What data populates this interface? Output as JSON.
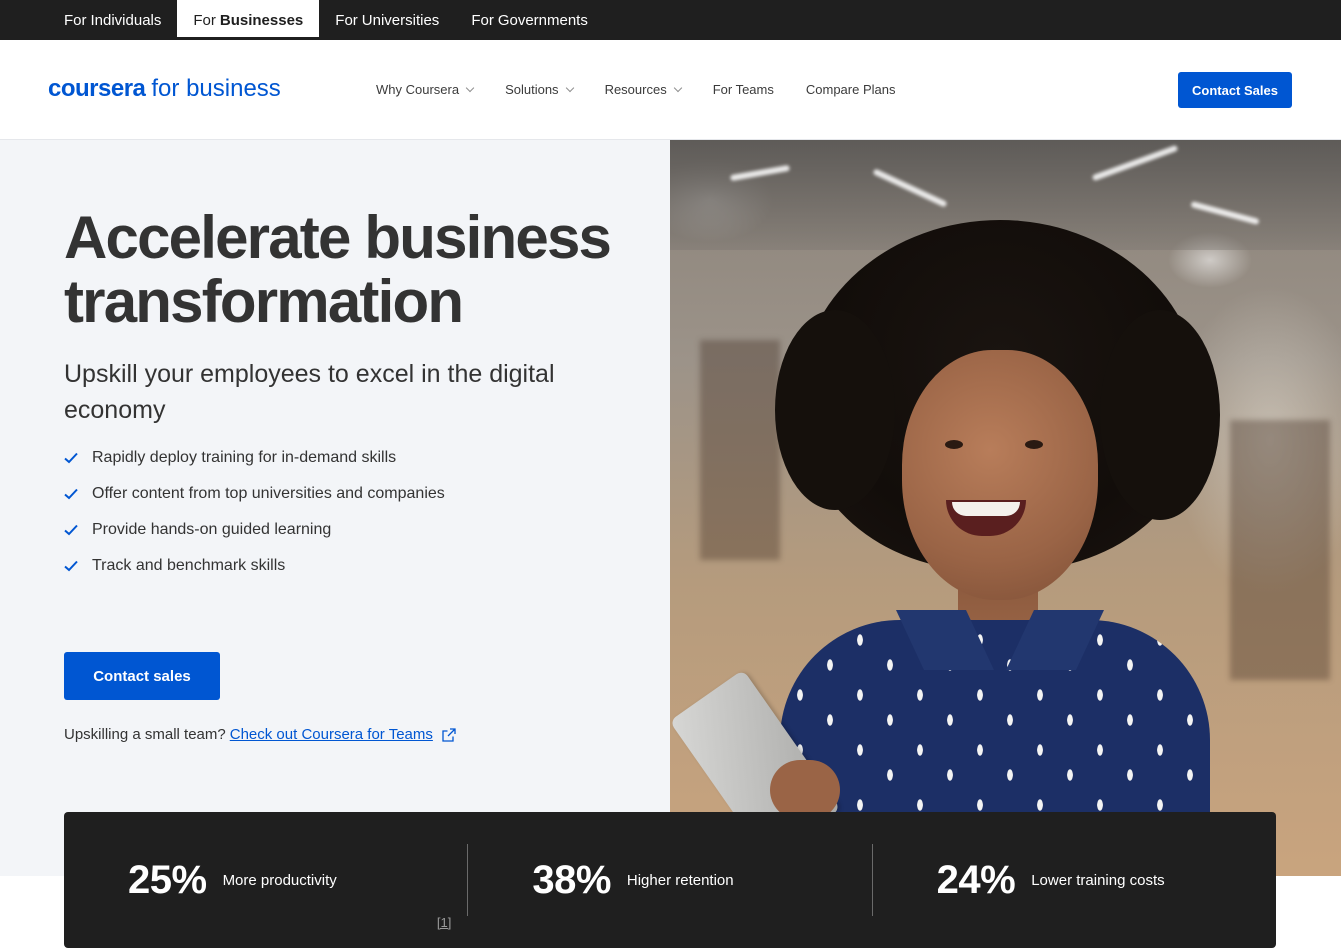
{
  "audience_tabs": [
    {
      "prefix": "For",
      "name": "Individuals",
      "active": false
    },
    {
      "prefix": "For",
      "name": "Businesses",
      "active": true
    },
    {
      "prefix": "For",
      "name": "Universities",
      "active": false
    },
    {
      "prefix": "For",
      "name": "Governments",
      "active": false
    }
  ],
  "header": {
    "logo_brand": "coursera",
    "logo_suffix": "for business",
    "nav": [
      {
        "label": "Why Coursera",
        "dropdown": true
      },
      {
        "label": "Solutions",
        "dropdown": true
      },
      {
        "label": "Resources",
        "dropdown": true
      },
      {
        "label": "For Teams",
        "dropdown": false
      },
      {
        "label": "Compare Plans",
        "dropdown": false
      }
    ],
    "cta_label": "Contact Sales"
  },
  "hero": {
    "title": "Accelerate business transformation",
    "subtitle": "Upskill your employees to excel in the digital economy",
    "bullets": [
      "Rapidly deploy training for in-demand skills",
      "Offer content from top universities and companies",
      "Provide hands-on guided learning",
      "Track and benchmark skills"
    ],
    "cta_label": "Contact sales",
    "teams_prompt": "Upskilling a small team?",
    "teams_link": "Check out Coursera for Teams"
  },
  "stats": [
    {
      "value": "25%",
      "label": "More productivity",
      "footnote": "[1]"
    },
    {
      "value": "38%",
      "label": "Higher retention"
    },
    {
      "value": "24%",
      "label": "Lower training costs"
    }
  ],
  "colors": {
    "brand_blue": "#0056d2",
    "dark_bar": "#1f1f1f",
    "hero_bg": "#f3f5f8"
  },
  "icons": {
    "bullet": "check-icon",
    "link": "external-link-icon",
    "dropdown": "chevron-down-icon"
  }
}
